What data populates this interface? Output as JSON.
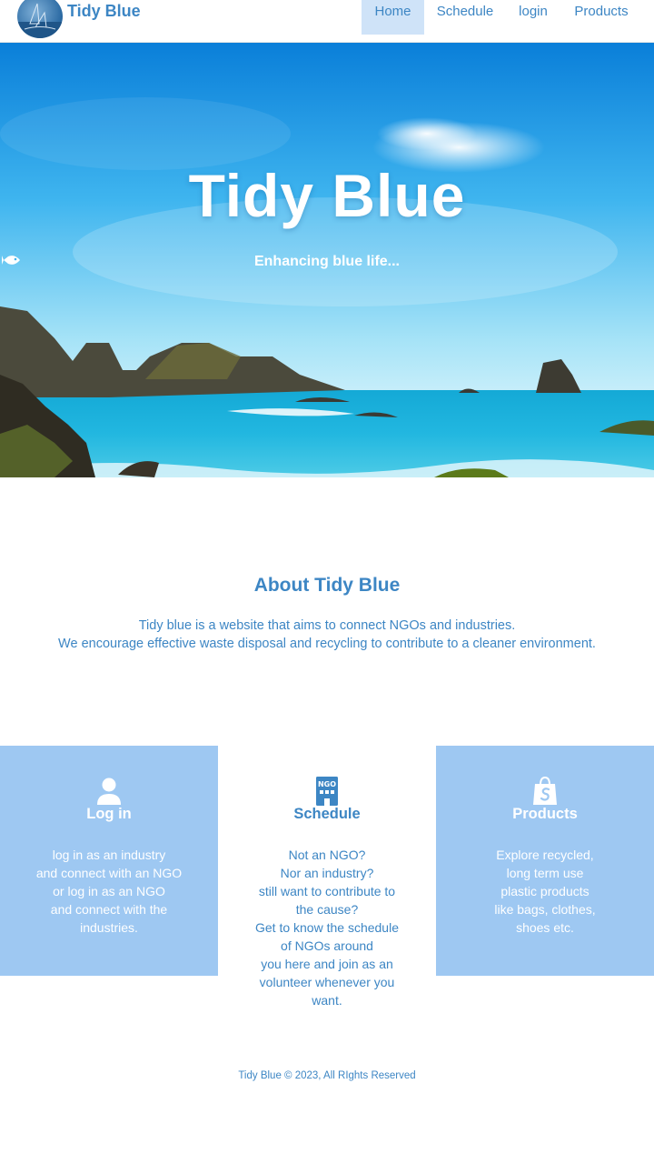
{
  "nav": {
    "brand": "Tidy Blue",
    "links": [
      {
        "label": "Home",
        "active": true
      },
      {
        "label": "Schedule",
        "active": false
      },
      {
        "label": "login",
        "active": false
      },
      {
        "label": "Products",
        "active": false
      }
    ]
  },
  "hero": {
    "title": "Tidy Blue",
    "subtitle": "Enhancing blue life...",
    "subtitle_icon": "fish-icon"
  },
  "about": {
    "title": "About Tidy Blue",
    "lines": [
      "Tidy blue is a website that aims to connect NGOs and industries.",
      "We encourage effective waste disposal and recycling to contribute to a cleaner environment."
    ]
  },
  "cards": [
    {
      "icon": "user-icon",
      "title": "Log in",
      "lines": [
        "log in as an industry",
        "and connect with an NGO",
        "or log in as an NGO",
        "and connect with the",
        "industries."
      ]
    },
    {
      "icon": "ngo-building-icon",
      "icon_text": "NGO",
      "title": "Schedule",
      "lines": [
        "Not an NGO?",
        "Nor an industry?",
        "still want to contribute to",
        "the cause?",
        "Get to know the schedule",
        "of NGOs around",
        "you here and join as an",
        "volunteer whenever you",
        "want."
      ]
    },
    {
      "icon": "shopify-bag-icon",
      "title": "Products",
      "lines": [
        "Explore recycled,",
        "long term use",
        "plastic products",
        "like bags, clothes,",
        "shoes etc."
      ]
    }
  ],
  "footer": {
    "text": "Tidy Blue © 2023, All RIghts Reserved"
  },
  "colors": {
    "accent": "#3d86c4",
    "card_blue": "#9ec8f2",
    "nav_active_bg": "#cfe3f8"
  }
}
